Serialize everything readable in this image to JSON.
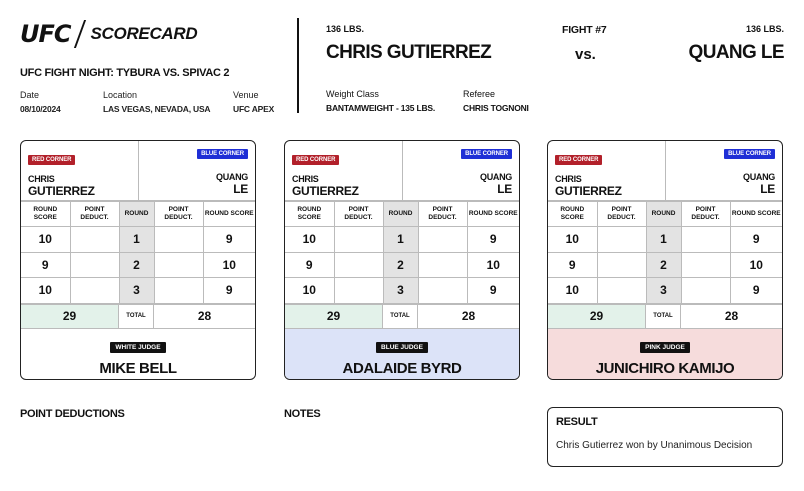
{
  "header": {
    "logo_ufc": "UFC",
    "logo_scorecard": "SCORECARD",
    "event_title": "UFC FIGHT NIGHT: TYBURA VS. SPIVAC 2",
    "date_label": "Date",
    "date_value": "08/10/2024",
    "location_label": "Location",
    "location_value": "LAS VEGAS, NEVADA, USA",
    "venue_label": "Venue",
    "venue_value": "UFC APEX"
  },
  "fight": {
    "red_weight": "136 LBS.",
    "red_name": "CHRIS GUTIERREZ",
    "fight_number": "FIGHT #7",
    "vs": "vs.",
    "blue_weight": "136 LBS.",
    "blue_name": "QUANG LE",
    "weight_class_label": "Weight Class",
    "weight_class_value": "BANTAMWEIGHT - 135 LBS.",
    "referee_label": "Referee",
    "referee_value": "CHRIS TOGNONI"
  },
  "labels": {
    "red_corner": "RED CORNER",
    "blue_corner": "BLUE CORNER",
    "red_first": "CHRIS",
    "red_last": "GUTIERREZ",
    "blue_first": "QUANG",
    "blue_last": "LE",
    "col_round_score": "ROUND SCORE",
    "col_point_deduct": "POINT DEDUCT.",
    "col_round": "ROUND",
    "total": "TOTAL"
  },
  "cards": [
    {
      "judge_badge": "WHITE JUDGE",
      "judge_name": "MIKE BELL",
      "rounds": [
        {
          "round": "1",
          "red": "10",
          "red_ded": "",
          "blue_ded": "",
          "blue": "9"
        },
        {
          "round": "2",
          "red": "9",
          "red_ded": "",
          "blue_ded": "",
          "blue": "10"
        },
        {
          "round": "3",
          "red": "10",
          "red_ded": "",
          "blue_ded": "",
          "blue": "9"
        }
      ],
      "red_total": "29",
      "blue_total": "28"
    },
    {
      "judge_badge": "BLUE JUDGE",
      "judge_name": "ADALAIDE BYRD",
      "rounds": [
        {
          "round": "1",
          "red": "10",
          "red_ded": "",
          "blue_ded": "",
          "blue": "9"
        },
        {
          "round": "2",
          "red": "9",
          "red_ded": "",
          "blue_ded": "",
          "blue": "10"
        },
        {
          "round": "3",
          "red": "10",
          "red_ded": "",
          "blue_ded": "",
          "blue": "9"
        }
      ],
      "red_total": "29",
      "blue_total": "28"
    },
    {
      "judge_badge": "PINK JUDGE",
      "judge_name": "JUNICHIRO KAMIJO",
      "rounds": [
        {
          "round": "1",
          "red": "10",
          "red_ded": "",
          "blue_ded": "",
          "blue": "9"
        },
        {
          "round": "2",
          "red": "9",
          "red_ded": "",
          "blue_ded": "",
          "blue": "10"
        },
        {
          "round": "3",
          "red": "10",
          "red_ded": "",
          "blue_ded": "",
          "blue": "9"
        }
      ],
      "red_total": "29",
      "blue_total": "28"
    }
  ],
  "footer": {
    "point_deductions": "POINT DEDUCTIONS",
    "notes": "NOTES",
    "result_title": "RESULT",
    "result_text": "Chris Gutierrez won by Unanimous Decision"
  },
  "colors": {
    "red_corner": "#b2202a",
    "blue_corner": "#1f2fd6",
    "red_total_bg": "#e3f2ea",
    "blue_judge_bg": "#dce3f8",
    "pink_judge_bg": "#f6dcdc"
  }
}
